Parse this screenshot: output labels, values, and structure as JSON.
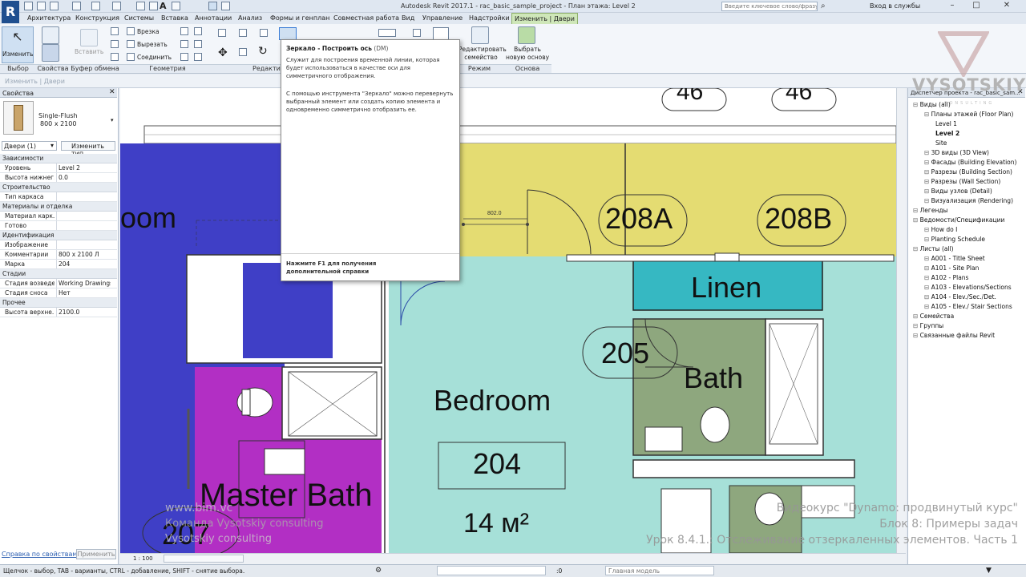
{
  "app": {
    "logo": "R",
    "window_title": "Autodesk Revit 2017.1 -   rac_basic_sample_project - План этажа: Level 2",
    "search_placeholder": "Введите ключевое слово/фразу",
    "login": "Вход в службы"
  },
  "tabs": [
    "Архитектура",
    "Конструкция",
    "Системы",
    "Вставка",
    "Аннотации",
    "Анализ",
    "Формы и генплан",
    "Совместная работа",
    "Вид",
    "Управление",
    "Надстройки",
    "Изменить | Двери"
  ],
  "ribbon": {
    "modify_label": "Изменить",
    "paste_label": "Вставить",
    "cut_label": "Врезка",
    "cut2_label": "Вырезать",
    "join_label": "Соединить",
    "edit_family_label": "Редактировать семейство",
    "pick_host_label": "Выбрать новую основу",
    "panels": {
      "select": "Выбор",
      "properties": "Свойства",
      "clipboard": "Буфер обмена",
      "geometry": "Геометрия",
      "modify": "Редактиров",
      "mode": "Режим",
      "host": "Основа"
    }
  },
  "context_bar": "Изменить | Двери",
  "tooltip": {
    "title": "Зеркало - Построить ось",
    "shortcut": "(DM)",
    "para1": "Служит для построения временной линии, которая будет использоваться в качестве оси для симметричного отображения.",
    "para2": "С помощью инструмента \"Зеркало\" можно перевернуть выбранный элемент или создать копию элемента и одновременно симметрично отобразить ее.",
    "footer": "Нажмите F1 для получения дополнительной справки"
  },
  "properties": {
    "header": "Свойства",
    "family": "Single-Flush",
    "size": "800 x 2100",
    "selector": "Двери (1)",
    "edit_type": "Изменить тип",
    "rows": [
      {
        "section": "Зависимости"
      },
      {
        "k": "Уровень",
        "v": "Level 2"
      },
      {
        "k": "Высота нижнег...",
        "v": "0.0"
      },
      {
        "section": "Строительство"
      },
      {
        "k": "Тип каркаса",
        "v": ""
      },
      {
        "section": "Материалы и отделка"
      },
      {
        "k": "Материал карк...",
        "v": ""
      },
      {
        "k": "Готово",
        "v": ""
      },
      {
        "section": "Идентификация"
      },
      {
        "k": "Изображение",
        "v": ""
      },
      {
        "k": "Комментарии",
        "v": "800 x 2100 Л"
      },
      {
        "k": "Марка",
        "v": "204"
      },
      {
        "section": "Стадии"
      },
      {
        "k": "Стадия возведе...",
        "v": "Working Drawings"
      },
      {
        "k": "Стадия сноса",
        "v": "Нет"
      },
      {
        "section": "Прочее"
      },
      {
        "k": "Высота верхне...",
        "v": "2100.0"
      }
    ],
    "help_link": "Справка по свойствам",
    "apply": "Применить"
  },
  "canvas": {
    "scale": "1 : 100",
    "dim": "802.0",
    "rooms": {
      "bedroom_partial": "oom",
      "r208a": "208A",
      "r208b": "208B",
      "linen": "Linen",
      "r205": "205",
      "bath": "Bath",
      "bedroom": "Bedroom",
      "r204": "204",
      "area": "14 м²",
      "master_bath": "Master Bath",
      "r207": "207",
      "top_tag": "46"
    },
    "colors": {
      "blue": "#3f3fc6",
      "yellow": "#e4dc72",
      "teal": "#a6e0d8",
      "magenta": "#b22fc4",
      "linen": "#36b8c2",
      "bath": "#8ea77e"
    }
  },
  "browser": {
    "header": "Диспетчер проекта - rac_basic_sam...",
    "items": [
      {
        "t": "Виды (all)",
        "lvl": 0,
        "bold": false
      },
      {
        "t": "Планы этажей (Floor Plan)",
        "lvl": 1,
        "bold": false
      },
      {
        "t": "Level 1",
        "lvl": 2,
        "bold": false
      },
      {
        "t": "Level 2",
        "lvl": 2,
        "bold": true
      },
      {
        "t": "Site",
        "lvl": 2,
        "bold": false
      },
      {
        "t": "3D виды (3D View)",
        "lvl": 1,
        "bold": false
      },
      {
        "t": "Фасады (Building Elevation)",
        "lvl": 1,
        "bold": false
      },
      {
        "t": "Разрезы (Building Section)",
        "lvl": 1,
        "bold": false
      },
      {
        "t": "Разрезы (Wall Section)",
        "lvl": 1,
        "bold": false
      },
      {
        "t": "Виды узлов (Detail)",
        "lvl": 1,
        "bold": false
      },
      {
        "t": "Визуализация (Rendering)",
        "lvl": 1,
        "bold": false
      },
      {
        "t": "Легенды",
        "lvl": 0,
        "bold": false
      },
      {
        "t": "Ведомости/Спецификации",
        "lvl": 0,
        "bold": false
      },
      {
        "t": "How do I",
        "lvl": 1,
        "bold": false
      },
      {
        "t": "Planting Schedule",
        "lvl": 1,
        "bold": false
      },
      {
        "t": "Листы (all)",
        "lvl": 0,
        "bold": false
      },
      {
        "t": "A001 - Title Sheet",
        "lvl": 1,
        "bold": false
      },
      {
        "t": "A101 - Site Plan",
        "lvl": 1,
        "bold": false
      },
      {
        "t": "A102 - Plans",
        "lvl": 1,
        "bold": false
      },
      {
        "t": "A103 - Elevations/Sections",
        "lvl": 1,
        "bold": false
      },
      {
        "t": "A104 - Elev./Sec./Det.",
        "lvl": 1,
        "bold": false
      },
      {
        "t": "A105 - Elev./ Stair Sections",
        "lvl": 1,
        "bold": false
      },
      {
        "t": "Семейства",
        "lvl": 0,
        "bold": false
      },
      {
        "t": "Группы",
        "lvl": 0,
        "bold": false
      },
      {
        "t": "Связанные файлы Revit",
        "lvl": 0,
        "bold": false
      }
    ]
  },
  "watermark": {
    "brand": "VYSOTSKIY",
    "sub": "CONSULTING",
    "site": "www.bim.vc",
    "team": "Команда Vysotskiy consulting",
    "team2": "Vysotskiy consulting",
    "course1": "Видеокурс \"Dynamo: продвинутый курс\"",
    "course2": "Блок 8: Примеры задач",
    "course3": "Урок 8.4.1.: Отслеживание отзеркаленных элементов. Часть 1"
  },
  "status": {
    "text": "Щелчок - выбор, TAB - варианты, CTRL - добавление, SHIFT - снятие выбора.",
    "zero": ":0",
    "model": "Главная модель"
  }
}
